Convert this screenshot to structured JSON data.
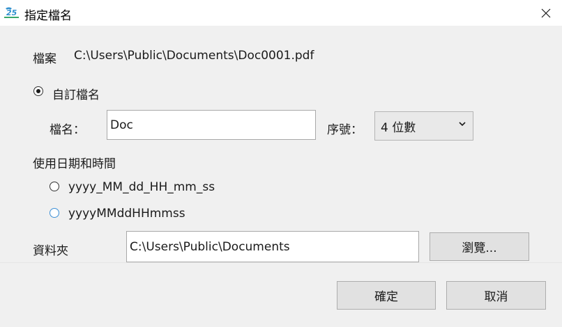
{
  "window": {
    "title": "指定檔名"
  },
  "file": {
    "label": "檔案",
    "path": "C:\\Users\\Public\\Documents\\Doc0001.pdf"
  },
  "custom_name": {
    "option_label": "自訂檔名",
    "name_label": "檔名：",
    "name_value": "Doc",
    "serial_label": "序號：",
    "serial_selected": "4 位數"
  },
  "datetime": {
    "section_label": "使用日期和時間",
    "formats": [
      "yyyy_MM_dd_HH_mm_ss",
      "yyyyMMddHHmmss"
    ]
  },
  "folder": {
    "label": "資料夾",
    "value": "C:\\Users\\Public\\Documents",
    "browse_label": "瀏覽..."
  },
  "footer": {
    "ok_label": "確定",
    "cancel_label": "取消"
  }
}
